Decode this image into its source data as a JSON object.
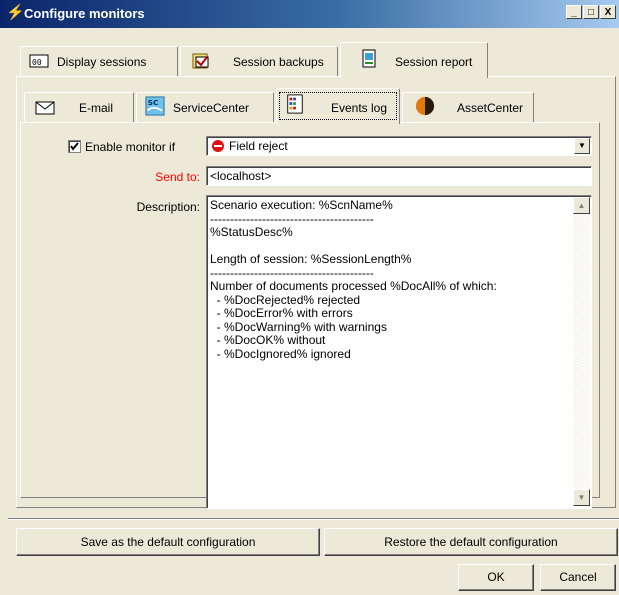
{
  "window": {
    "title": "Configure monitors",
    "controls": {
      "minimize": "_",
      "maximize": "□",
      "close": "X"
    }
  },
  "outer_tabs": [
    {
      "label": "Display sessions",
      "icon": "display-sessions-icon"
    },
    {
      "label": "Session backups",
      "icon": "session-backups-icon"
    },
    {
      "label": "Session report",
      "icon": "session-report-icon",
      "selected": true
    }
  ],
  "inner_tabs": [
    {
      "label": "E-mail",
      "icon": "envelope-icon"
    },
    {
      "label": "ServiceCenter",
      "icon": "servicecenter-icon"
    },
    {
      "label": "Events log",
      "icon": "events-log-icon",
      "selected": true
    },
    {
      "label": "AssetCenter",
      "icon": "assetcenter-icon"
    }
  ],
  "form": {
    "enable_monitor": {
      "label": "Enable monitor if",
      "checked": true
    },
    "condition": {
      "value": "Field reject",
      "icon": "field-reject-icon"
    },
    "send_to": {
      "label": "Send to:",
      "value": "<localhost>",
      "label_color": "#ff0000"
    },
    "description": {
      "label": "Description:",
      "lines": [
        "Scenario execution: %ScnName%",
        "-----------------------------------------",
        "%StatusDesc%",
        "",
        "Length of session: %SessionLength%",
        "-----------------------------------------",
        "Number of documents processed %DocAll% of which:",
        "  - %DocRejected% rejected",
        "  - %DocError% with errors",
        "  - %DocWarning% with warnings",
        "  - %DocOK% without",
        "  - %DocIgnored% ignored"
      ]
    }
  },
  "footer": {
    "save_default": "Save as the default configuration",
    "restore_default": "Restore the default configuration",
    "ok": "OK",
    "cancel": "Cancel"
  },
  "colors": {
    "title_start": "#0a246a",
    "title_end": "#a6caf0",
    "window_bg": "#ece9d8",
    "required_label": "#ff0000"
  }
}
